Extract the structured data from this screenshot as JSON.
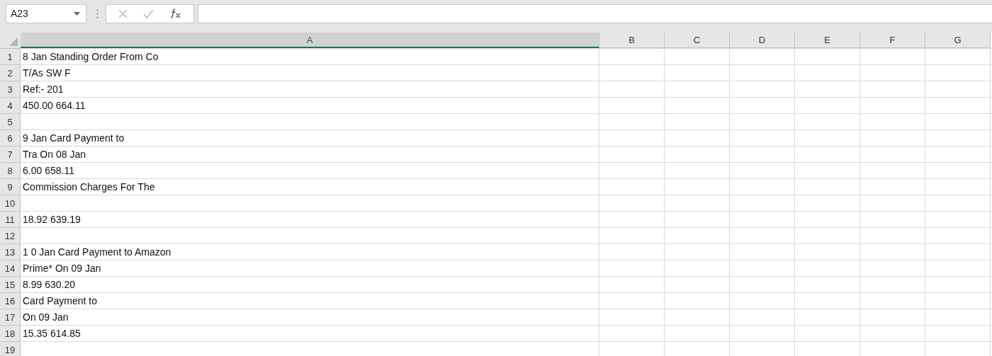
{
  "formula_bar": {
    "name_box": "A23"
  },
  "columns": [
    {
      "label": "A",
      "selected": true
    },
    {
      "label": "B",
      "selected": false
    },
    {
      "label": "C",
      "selected": false
    },
    {
      "label": "D",
      "selected": false
    },
    {
      "label": "E",
      "selected": false
    },
    {
      "label": "F",
      "selected": false
    },
    {
      "label": "G",
      "selected": false
    }
  ],
  "rows": [
    {
      "number": "1",
      "cells": [
        "8 Jan Standing Order From Co"
      ]
    },
    {
      "number": "2",
      "cells": [
        "T/As SW F"
      ]
    },
    {
      "number": "3",
      "cells": [
        "Ref:- 201"
      ]
    },
    {
      "number": "4",
      "cells": [
        "450.00 664.11"
      ]
    },
    {
      "number": "5",
      "cells": []
    },
    {
      "number": "6",
      "cells": [
        "9 Jan Card Payment to"
      ]
    },
    {
      "number": "7",
      "cells": [
        "Tra On 08 Jan"
      ]
    },
    {
      "number": "8",
      "cells": [
        "6.00 658.11"
      ]
    },
    {
      "number": "9",
      "cells": [
        "Commission Charges For The"
      ]
    },
    {
      "number": "10",
      "cells": []
    },
    {
      "number": "11",
      "cells": [
        "18.92 639.19"
      ]
    },
    {
      "number": "12",
      "cells": []
    },
    {
      "number": "13",
      "cells": [
        "1 0 Jan Card Payment to Amazon"
      ]
    },
    {
      "number": "14",
      "cells": [
        "Prime* On 09 Jan"
      ]
    },
    {
      "number": "15",
      "cells": [
        "8.99 630.20"
      ]
    },
    {
      "number": "16",
      "cells": [
        "Card Payment to"
      ]
    },
    {
      "number": "17",
      "cells": [
        "On 09 Jan"
      ]
    },
    {
      "number": "18",
      "cells": [
        "15.35 614.85"
      ]
    },
    {
      "number": "19",
      "cells": []
    }
  ]
}
